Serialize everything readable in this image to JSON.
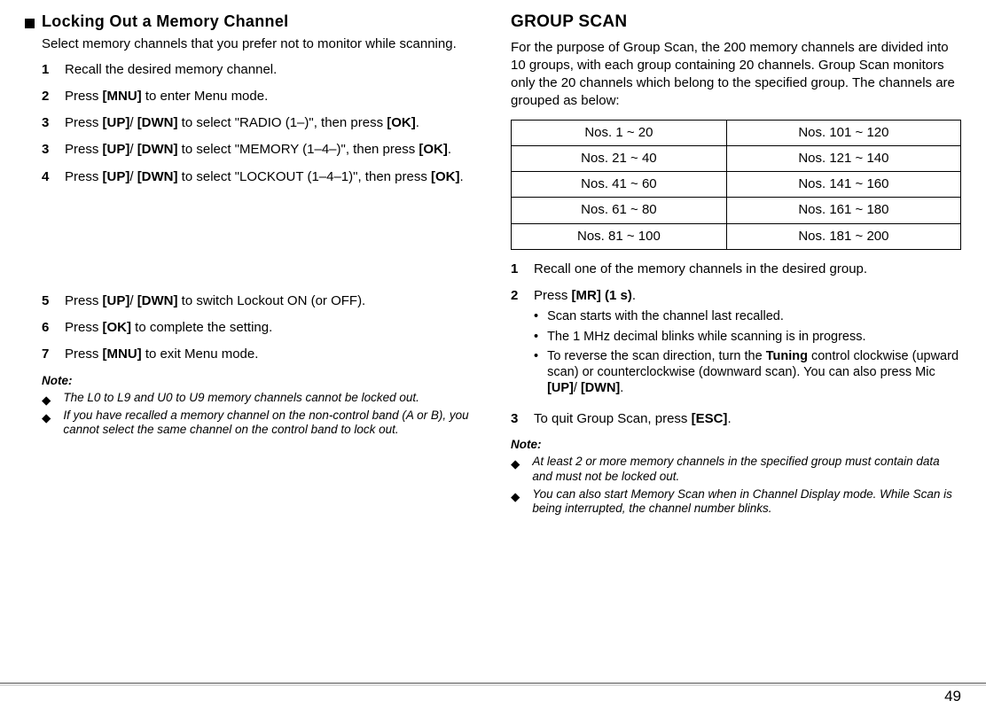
{
  "left": {
    "section_title": "Locking Out a Memory Channel",
    "intro": "Select memory channels that you prefer not to monitor while scanning.",
    "steps_a": [
      {
        "n": "1",
        "t": "Recall the desired memory channel."
      },
      {
        "n": "2",
        "t": "Press <b>[MNU]</b> to enter Menu mode."
      },
      {
        "n": "3",
        "t": "Press <b>[UP]</b>/ <b>[DWN]</b> to select \"RADIO (1–)\", then press <b>[OK]</b>."
      },
      {
        "n": "3",
        "t": "Press <b>[UP]</b>/ <b>[DWN]</b> to select \"MEMORY (1–4–)\", then press <b>[OK]</b>."
      },
      {
        "n": "4",
        "t": "Press <b>[UP]</b>/ <b>[DWN]</b> to select \"LOCKOUT (1–4–1)\", then press <b>[OK]</b>."
      }
    ],
    "steps_b": [
      {
        "n": "5",
        "t": "Press <b>[UP]</b>/ <b>[DWN]</b> to switch Lockout ON (or OFF)."
      },
      {
        "n": "6",
        "t": "Press <b>[OK]</b> to complete the setting."
      },
      {
        "n": "7",
        "t": "Press <b>[MNU]</b> to exit Menu mode."
      }
    ],
    "note_label": "Note:",
    "notes": [
      "The L0 to L9 and U0 to U9 memory channels cannot be locked out.",
      "If you have recalled a memory channel on the non-control band (A or B), you cannot select the same channel on the control band to lock out."
    ]
  },
  "right": {
    "title": "GROUP SCAN",
    "intro": "For the purpose of Group Scan, the 200 memory channels are divided into 10 groups, with each group containing 20 channels.  Group Scan monitors only the 20 channels which belong to the specified group.  The channels are grouped as below:",
    "table": [
      [
        "Nos. 1 ~ 20",
        "Nos. 101 ~ 120"
      ],
      [
        "Nos. 21 ~ 40",
        "Nos. 121 ~ 140"
      ],
      [
        "Nos. 41 ~ 60",
        "Nos. 141 ~ 160"
      ],
      [
        "Nos. 61 ~ 80",
        "Nos. 161 ~ 180"
      ],
      [
        "Nos. 81 ~ 100",
        "Nos. 181 ~ 200"
      ]
    ],
    "steps": [
      {
        "n": "1",
        "t": "Recall one of the memory channels in the desired group."
      },
      {
        "n": "2",
        "t": "Press <b>[MR] (1 s)</b>.",
        "subs": [
          "Scan starts with the channel last recalled.",
          "The 1 MHz decimal blinks while scanning is in progress.",
          "To reverse the scan direction, turn the <b>Tuning</b> control clockwise (upward scan) or counterclockwise (downward scan).  You can also press Mic <b>[UP]</b>/ <b>[DWN]</b>."
        ]
      },
      {
        "n": "3",
        "t": "To quit Group Scan, press <b>[ESC]</b>."
      }
    ],
    "note_label": "Note:",
    "notes": [
      "At least 2 or more memory channels in the specified group must contain data and must not be locked out.",
      "You can also start Memory Scan when in Channel Display mode. While Scan is being interrupted, the channel number blinks."
    ]
  },
  "page_number": "49"
}
